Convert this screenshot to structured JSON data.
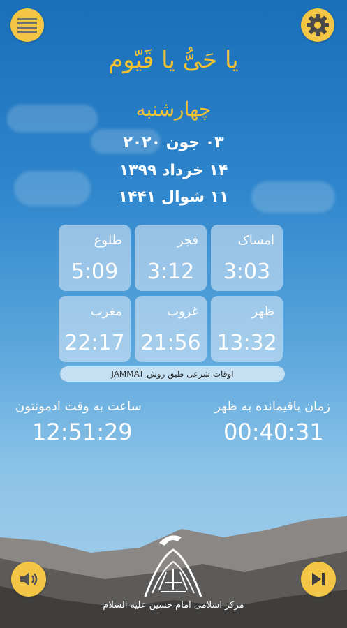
{
  "header": {
    "menu_icon": "hamburger-menu-icon",
    "settings_icon": "gear-icon"
  },
  "title": "یا حَیُّ یا قَیّوم",
  "weekday": "چهارشنبه",
  "dates": {
    "gregorian": "۰۳ جون ۲۰۲۰",
    "solar": "۱۴ خرداد ۱۳۹۹",
    "lunar": "۱۱ شوال ۱۴۴۱"
  },
  "prayer_times": [
    {
      "name": "امساک",
      "time": "3:03"
    },
    {
      "name": "فجر",
      "time": "3:12"
    },
    {
      "name": "طلوع",
      "time": "5:09"
    },
    {
      "name": "ظهر",
      "time": "13:32"
    },
    {
      "name": "غروب",
      "time": "21:56"
    },
    {
      "name": "مغرب",
      "time": "22:17"
    }
  ],
  "method_label": "اوقات شرعی طبق روش JAMMAT",
  "remaining": {
    "label": "زمان باقیمانده به ظهر",
    "value": "00:40:31"
  },
  "clock": {
    "label": "ساعت به وقت ادمونتون",
    "value": "12:51:29"
  },
  "footer": {
    "organization": "مرکز اسلامی امام حسین علیه السلام",
    "sound_icon": "speaker-icon",
    "next_icon": "skip-next-icon"
  },
  "colors": {
    "accent": "#f1c232",
    "sky_top": "#1a6fb8",
    "mountain": "#5c5c5c"
  }
}
